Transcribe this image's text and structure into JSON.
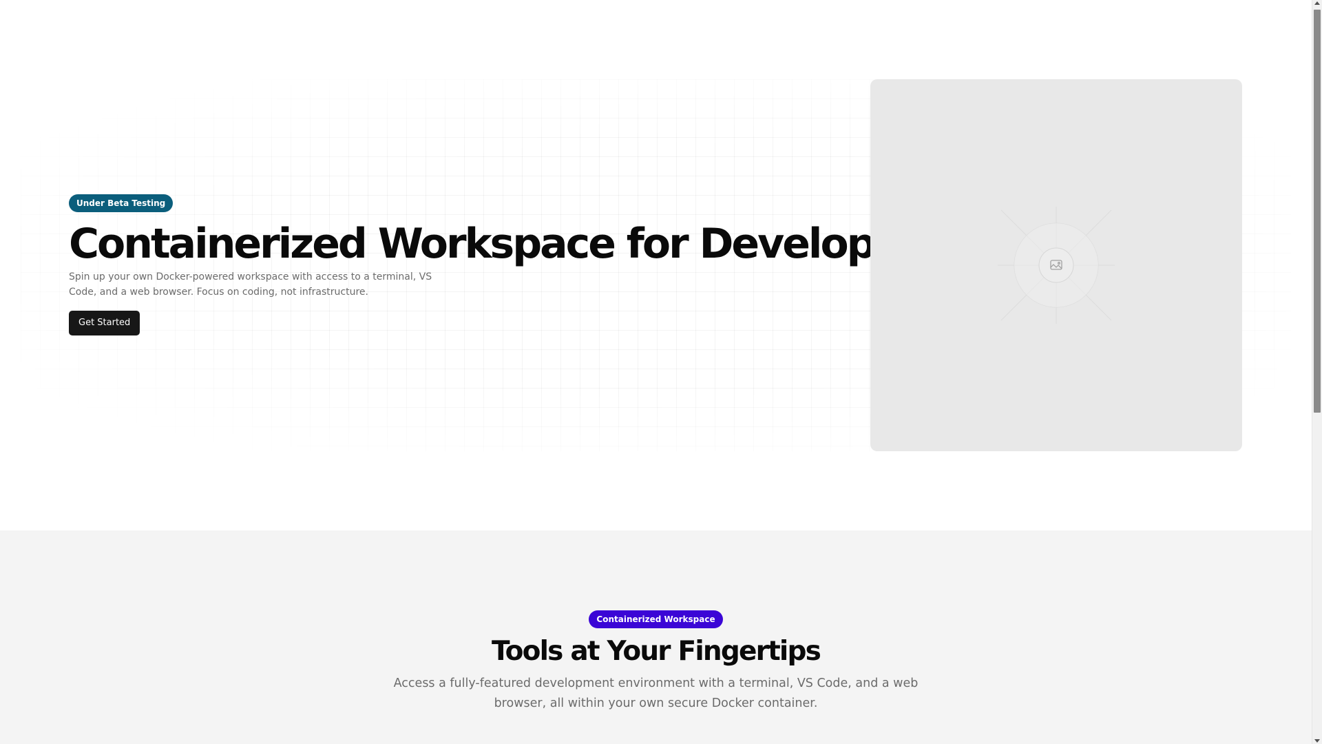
{
  "hero": {
    "badge": "Under Beta Testing",
    "title": "Containerized Workspace for Developers",
    "subtitle": "Spin up your own Docker-powered workspace with access to a terminal, VS Code, and a web browser. Focus on coding, not infrastructure.",
    "cta_label": "Get Started",
    "image_icon": "image-icon"
  },
  "features": {
    "badge": "Containerized Workspace",
    "title": "Tools at Your Fingertips",
    "subtitle": "Access a fully-featured development environment with a terminal, VS Code, and a web browser, all within your own secure Docker container."
  },
  "colors": {
    "beta_badge": "#0b5e7c",
    "features_badge": "#3b06d6",
    "button": "#171717",
    "placeholder_bg": "#e8e8e8",
    "features_bg": "#f4f4f4"
  }
}
